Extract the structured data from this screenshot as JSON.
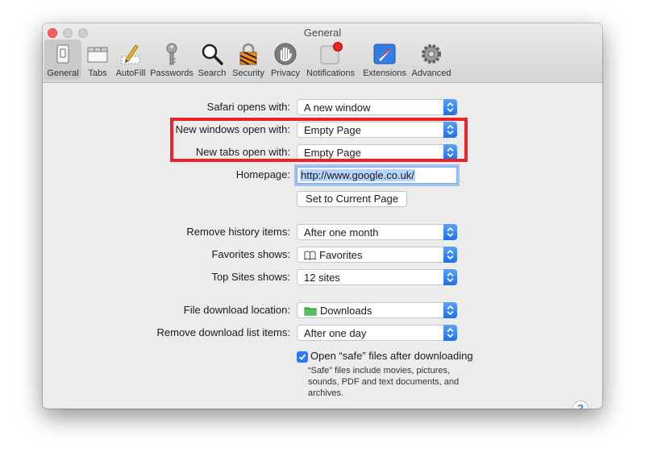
{
  "window": {
    "title": "General"
  },
  "toolbar": {
    "items": [
      {
        "label": "General",
        "icon": "general-switch-icon",
        "selected": true
      },
      {
        "label": "Tabs",
        "icon": "tabs-icon"
      },
      {
        "label": "AutoFill",
        "icon": "autofill-pencil-icon"
      },
      {
        "label": "Passwords",
        "icon": "key-icon"
      },
      {
        "label": "Search",
        "icon": "magnifier-icon"
      },
      {
        "label": "Security",
        "icon": "padlock-icon"
      },
      {
        "label": "Privacy",
        "icon": "hand-icon"
      },
      {
        "label": "Notifications",
        "icon": "notification-badge-icon"
      },
      {
        "label": "Extensions",
        "icon": "compass-icon"
      },
      {
        "label": "Advanced",
        "icon": "gear-icon"
      }
    ]
  },
  "settings": {
    "safari_opens_with": {
      "label": "Safari opens with:",
      "value": "A new window"
    },
    "new_windows_open_with": {
      "label": "New windows open with:",
      "value": "Empty Page"
    },
    "new_tabs_open_with": {
      "label": "New tabs open with:",
      "value": "Empty Page"
    },
    "homepage": {
      "label": "Homepage:",
      "value": "http://www.google.co.uk/"
    },
    "set_current_page": {
      "label": "Set to Current Page"
    },
    "remove_history": {
      "label": "Remove history items:",
      "value": "After one month"
    },
    "favorites_shows": {
      "label": "Favorites shows:",
      "value": "Favorites"
    },
    "top_sites_shows": {
      "label": "Top Sites shows:",
      "value": "12 sites"
    },
    "download_location": {
      "label": "File download location:",
      "value": "Downloads"
    },
    "remove_download": {
      "label": "Remove download list items:",
      "value": "After one day"
    },
    "open_safe_files": {
      "label": "Open “safe” files after downloading",
      "checked": true,
      "note": "“Safe” files include movies, pictures, sounds, PDF and text documents, and archives."
    }
  },
  "help": {
    "label": "?"
  },
  "colors": {
    "accent": "#2a7bf2",
    "highlight": "#e8232b",
    "close": "#fc5f57"
  }
}
